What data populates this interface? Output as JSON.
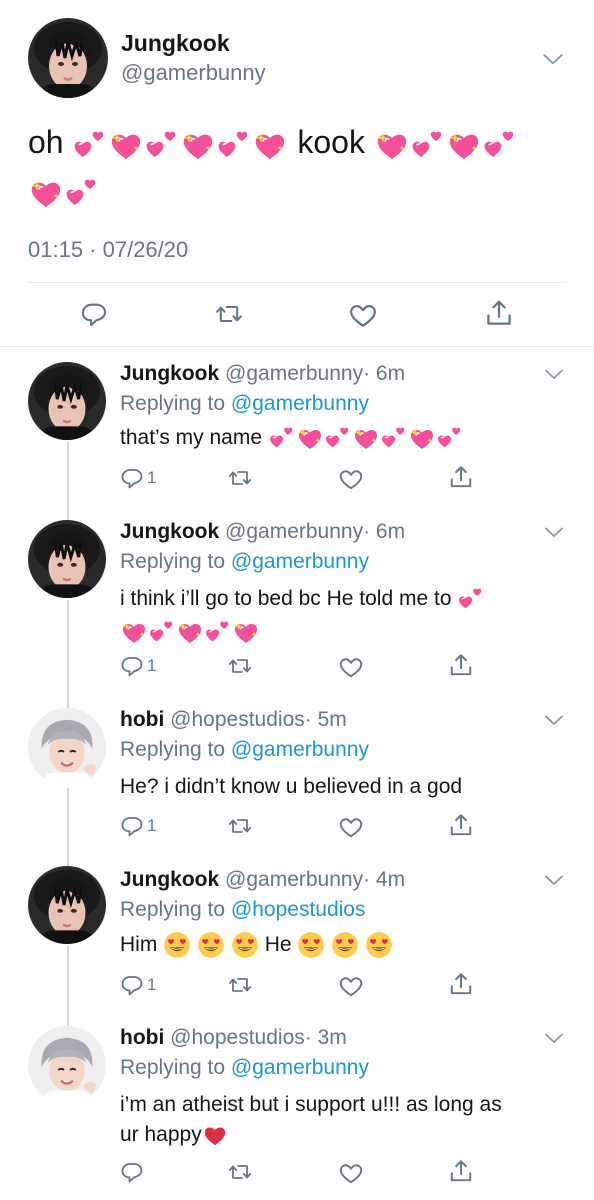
{
  "main_tweet": {
    "name": "Jungkook",
    "handle": "@gamerbunny",
    "text_oh": "oh",
    "text_kook": "kook",
    "timestamp": "01:15 · 07/26/20",
    "emoji_line1_before": [
      "revolving-hearts",
      "sparkling-heart",
      "revolving-hearts",
      "sparkling-heart",
      "revolving-hearts",
      "sparkling-heart"
    ],
    "emoji_line1_after": [
      "sparkling-heart",
      "revolving-hearts",
      "sparkling-heart",
      "revolving-hearts"
    ],
    "emoji_line2": [
      "sparkling-heart",
      "revolving-hearts"
    ]
  },
  "replies": [
    {
      "name": "Jungkook",
      "handle": "@gamerbunny",
      "time": "· 6m",
      "replying_prefix": "Replying to",
      "replying_to": "@gamerbunny",
      "text": "that’s my name",
      "reply_count": "1"
    },
    {
      "name": "Jungkook",
      "handle": "@gamerbunny",
      "time": "· 6m",
      "replying_prefix": "Replying to",
      "replying_to": "@gamerbunny",
      "text": "i think i’ll go to bed bc He told me to",
      "reply_count": "1"
    },
    {
      "name": "hobi",
      "handle": "@hopestudios",
      "time": "· 5m",
      "replying_prefix": "Replying to",
      "replying_to": "@gamerbunny",
      "text": "He? i didn’t know u believed in a god",
      "reply_count": "1"
    },
    {
      "name": "Jungkook",
      "handle": "@gamerbunny",
      "time": "· 4m",
      "replying_prefix": "Replying to",
      "replying_to": "@hopestudios",
      "text_him": "Him",
      "text_he": "He",
      "reply_count": "1"
    },
    {
      "name": "hobi",
      "handle": "@hopestudios",
      "time": "· 3m",
      "replying_prefix": "Replying to",
      "replying_to": "@gamerbunny",
      "text_line1": "i’m an atheist but i support u!!! as long as",
      "text_line2": "ur happy",
      "reply_count": ""
    }
  ],
  "colors": {
    "text": "#14171a",
    "secondary": "#657786",
    "link": "#1b95e0",
    "divider": "#e6ecf0",
    "thread_line": "#ccd6dd",
    "heart_pink": "#f4509a"
  }
}
